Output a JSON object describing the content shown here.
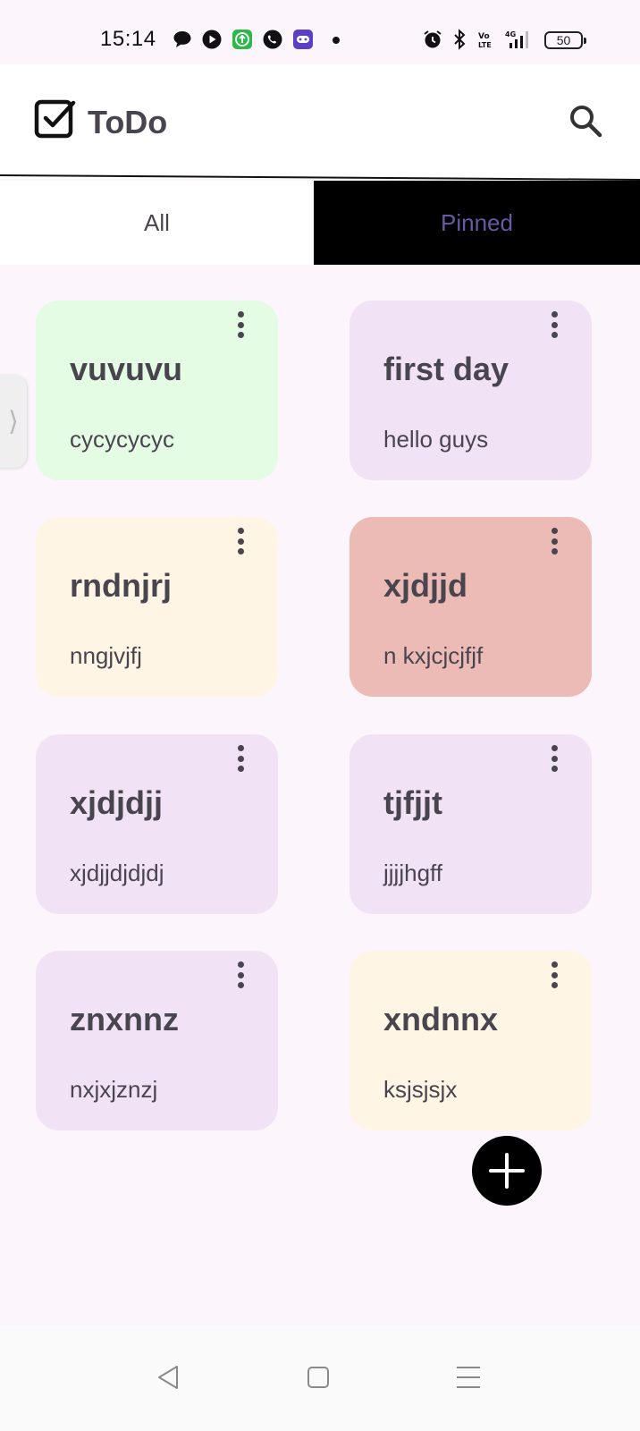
{
  "status_bar": {
    "time": "15:14",
    "battery": "50",
    "notification_icons": [
      "chat-bubble-icon",
      "play-icon",
      "upload-icon",
      "viber-icon",
      "game-icon"
    ],
    "system_icons": [
      "alarm-icon",
      "bluetooth-icon",
      "volte-icon",
      "signal-4g-icon",
      "battery-icon"
    ]
  },
  "app_bar": {
    "title": "ToDo",
    "logo_icon": "checkbox-icon",
    "search_icon": "search-icon"
  },
  "tabs": [
    {
      "label": "All",
      "selected": false
    },
    {
      "label": "Pinned",
      "selected": true
    }
  ],
  "notes": [
    {
      "title": "vuvuvu",
      "body": "cycycycyc",
      "color": "#e4fce3"
    },
    {
      "title": "first day",
      "body": "hello guys",
      "color": "#f1e3f5"
    },
    {
      "title": "rndnjrj",
      "body": "nngjvjfj",
      "color": "#fff5e5"
    },
    {
      "title": "xjdjjd",
      "body": "n kxjcjcjfjf",
      "color": "#ecbbb5"
    },
    {
      "title": "xjdjdjj",
      "body": "xjdjjdjdjdj",
      "color": "#f1e3f5"
    },
    {
      "title": "tjfjjt",
      "body": "jjjjhgff",
      "color": "#f1e3f5"
    },
    {
      "title": "znxnnz",
      "body": "nxjxjznzj",
      "color": "#f1e3f5"
    },
    {
      "title": "xndnnx",
      "body": "ksjsjsjx",
      "color": "#fff5e5"
    }
  ],
  "fab": {
    "icon": "plus-icon"
  },
  "nav_bar": {
    "icons": [
      "back-icon",
      "home-icon",
      "recents-icon"
    ]
  }
}
